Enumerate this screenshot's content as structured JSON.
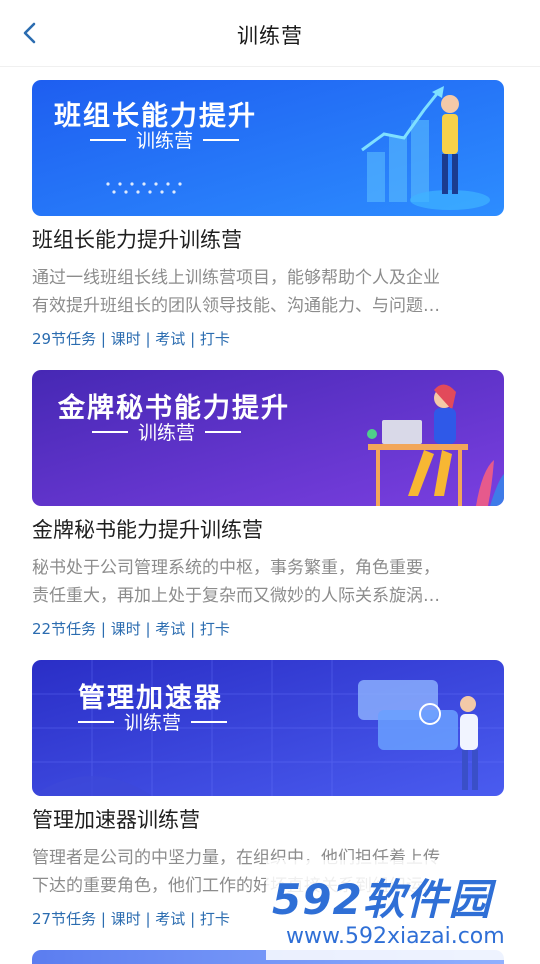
{
  "header": {
    "title": "训练营"
  },
  "camps": [
    {
      "banner_title": "班组长能力提升",
      "banner_sub": "训练营",
      "title": "班组长能力提升训练营",
      "desc_line1": "通过一线班组长线上训练营项目，能够帮助个人及企业",
      "desc_line2": "有效提升班组长的团队领导技能、沟通能力、与问题…",
      "tasks": "29节任务",
      "tag1": "课时",
      "tag2": "考试",
      "tag3": "打卡",
      "colors": [
        "#1e63f0",
        "#2a8cff"
      ]
    },
    {
      "banner_title": "金牌秘书能力提升",
      "banner_sub": "训练营",
      "title": "金牌秘书能力提升训练营",
      "desc_line1": "秘书处于公司管理系统的中枢，事务繁重，角色重要，",
      "desc_line2": "责任重大，再加上处于复杂而又微妙的人际关系旋涡…",
      "tasks": "22节任务",
      "tag1": "课时",
      "tag2": "考试",
      "tag3": "打卡",
      "colors": [
        "#4a2bb8",
        "#7a3ee0"
      ]
    },
    {
      "banner_title": "管理加速器",
      "banner_sub": "训练营",
      "title": "管理加速器训练营",
      "desc_line1": "管理者是公司的中坚力量，在组织中，他们担任着上传",
      "desc_line2": "下达的重要角色，他们工作的好坏直接关系到组织运…",
      "tasks": "27节任务",
      "tag1": "课时",
      "tag2": "考试",
      "tag3": "打卡",
      "colors": [
        "#2a2fc8",
        "#4b5cf0"
      ]
    }
  ],
  "watermark": {
    "logo": "592软件园",
    "url": "www.592xiazai.com"
  }
}
